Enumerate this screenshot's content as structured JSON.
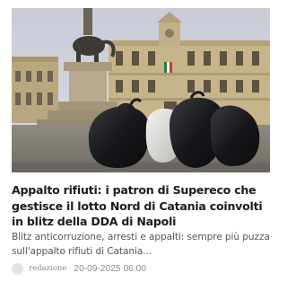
{
  "article": {
    "image_alt_icon": "photo-elephant-fountain-garbage-bags",
    "title": "Appalto rifiuti: i patron di Supereco che gestisce il lotto Nord di Catania coinvolti in blitz della DDA di Napoli",
    "excerpt": "Blitz anticorruzione, arresti e appalti: sempre più puzza sull'appalto rifiuti di Catania...",
    "author": "redazione",
    "date": "20-09-2025 06:00"
  }
}
